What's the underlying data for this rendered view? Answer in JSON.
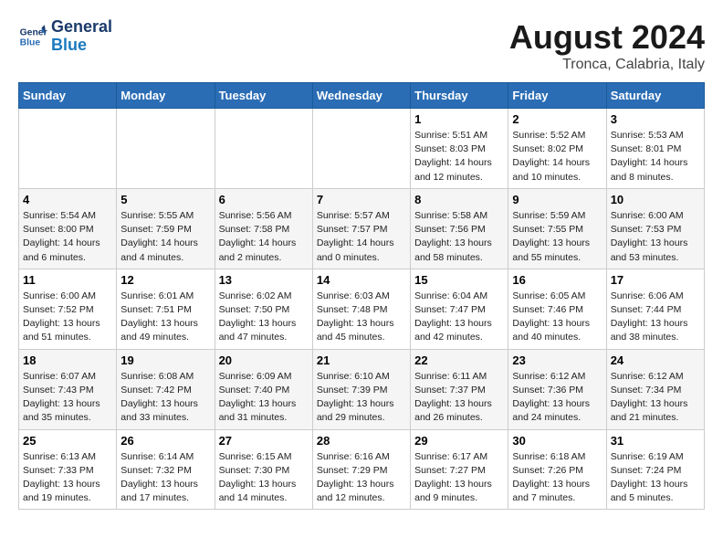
{
  "header": {
    "logo_line1": "General",
    "logo_line2": "Blue",
    "month": "August 2024",
    "location": "Tronca, Calabria, Italy"
  },
  "weekdays": [
    "Sunday",
    "Monday",
    "Tuesday",
    "Wednesday",
    "Thursday",
    "Friday",
    "Saturday"
  ],
  "weeks": [
    [
      {
        "day": "",
        "info": ""
      },
      {
        "day": "",
        "info": ""
      },
      {
        "day": "",
        "info": ""
      },
      {
        "day": "",
        "info": ""
      },
      {
        "day": "1",
        "info": "Sunrise: 5:51 AM\nSunset: 8:03 PM\nDaylight: 14 hours\nand 12 minutes."
      },
      {
        "day": "2",
        "info": "Sunrise: 5:52 AM\nSunset: 8:02 PM\nDaylight: 14 hours\nand 10 minutes."
      },
      {
        "day": "3",
        "info": "Sunrise: 5:53 AM\nSunset: 8:01 PM\nDaylight: 14 hours\nand 8 minutes."
      }
    ],
    [
      {
        "day": "4",
        "info": "Sunrise: 5:54 AM\nSunset: 8:00 PM\nDaylight: 14 hours\nand 6 minutes."
      },
      {
        "day": "5",
        "info": "Sunrise: 5:55 AM\nSunset: 7:59 PM\nDaylight: 14 hours\nand 4 minutes."
      },
      {
        "day": "6",
        "info": "Sunrise: 5:56 AM\nSunset: 7:58 PM\nDaylight: 14 hours\nand 2 minutes."
      },
      {
        "day": "7",
        "info": "Sunrise: 5:57 AM\nSunset: 7:57 PM\nDaylight: 14 hours\nand 0 minutes."
      },
      {
        "day": "8",
        "info": "Sunrise: 5:58 AM\nSunset: 7:56 PM\nDaylight: 13 hours\nand 58 minutes."
      },
      {
        "day": "9",
        "info": "Sunrise: 5:59 AM\nSunset: 7:55 PM\nDaylight: 13 hours\nand 55 minutes."
      },
      {
        "day": "10",
        "info": "Sunrise: 6:00 AM\nSunset: 7:53 PM\nDaylight: 13 hours\nand 53 minutes."
      }
    ],
    [
      {
        "day": "11",
        "info": "Sunrise: 6:00 AM\nSunset: 7:52 PM\nDaylight: 13 hours\nand 51 minutes."
      },
      {
        "day": "12",
        "info": "Sunrise: 6:01 AM\nSunset: 7:51 PM\nDaylight: 13 hours\nand 49 minutes."
      },
      {
        "day": "13",
        "info": "Sunrise: 6:02 AM\nSunset: 7:50 PM\nDaylight: 13 hours\nand 47 minutes."
      },
      {
        "day": "14",
        "info": "Sunrise: 6:03 AM\nSunset: 7:48 PM\nDaylight: 13 hours\nand 45 minutes."
      },
      {
        "day": "15",
        "info": "Sunrise: 6:04 AM\nSunset: 7:47 PM\nDaylight: 13 hours\nand 42 minutes."
      },
      {
        "day": "16",
        "info": "Sunrise: 6:05 AM\nSunset: 7:46 PM\nDaylight: 13 hours\nand 40 minutes."
      },
      {
        "day": "17",
        "info": "Sunrise: 6:06 AM\nSunset: 7:44 PM\nDaylight: 13 hours\nand 38 minutes."
      }
    ],
    [
      {
        "day": "18",
        "info": "Sunrise: 6:07 AM\nSunset: 7:43 PM\nDaylight: 13 hours\nand 35 minutes."
      },
      {
        "day": "19",
        "info": "Sunrise: 6:08 AM\nSunset: 7:42 PM\nDaylight: 13 hours\nand 33 minutes."
      },
      {
        "day": "20",
        "info": "Sunrise: 6:09 AM\nSunset: 7:40 PM\nDaylight: 13 hours\nand 31 minutes."
      },
      {
        "day": "21",
        "info": "Sunrise: 6:10 AM\nSunset: 7:39 PM\nDaylight: 13 hours\nand 29 minutes."
      },
      {
        "day": "22",
        "info": "Sunrise: 6:11 AM\nSunset: 7:37 PM\nDaylight: 13 hours\nand 26 minutes."
      },
      {
        "day": "23",
        "info": "Sunrise: 6:12 AM\nSunset: 7:36 PM\nDaylight: 13 hours\nand 24 minutes."
      },
      {
        "day": "24",
        "info": "Sunrise: 6:12 AM\nSunset: 7:34 PM\nDaylight: 13 hours\nand 21 minutes."
      }
    ],
    [
      {
        "day": "25",
        "info": "Sunrise: 6:13 AM\nSunset: 7:33 PM\nDaylight: 13 hours\nand 19 minutes."
      },
      {
        "day": "26",
        "info": "Sunrise: 6:14 AM\nSunset: 7:32 PM\nDaylight: 13 hours\nand 17 minutes."
      },
      {
        "day": "27",
        "info": "Sunrise: 6:15 AM\nSunset: 7:30 PM\nDaylight: 13 hours\nand 14 minutes."
      },
      {
        "day": "28",
        "info": "Sunrise: 6:16 AM\nSunset: 7:29 PM\nDaylight: 13 hours\nand 12 minutes."
      },
      {
        "day": "29",
        "info": "Sunrise: 6:17 AM\nSunset: 7:27 PM\nDaylight: 13 hours\nand 9 minutes."
      },
      {
        "day": "30",
        "info": "Sunrise: 6:18 AM\nSunset: 7:26 PM\nDaylight: 13 hours\nand 7 minutes."
      },
      {
        "day": "31",
        "info": "Sunrise: 6:19 AM\nSunset: 7:24 PM\nDaylight: 13 hours\nand 5 minutes."
      }
    ]
  ]
}
